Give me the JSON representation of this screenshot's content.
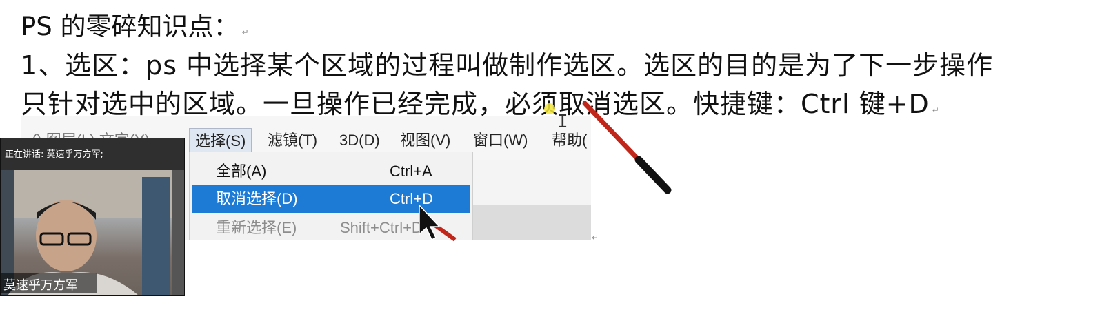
{
  "document": {
    "title": "PS 的零碎知识点：",
    "line1": "1、选区：ps 中选择某个区域的过程叫做制作选区。选区的目的是为了下一步操作",
    "line2": "只针对选中的区域。一旦操作已经完成，必须取消选区。快捷键：Ctrl 键+D",
    "return_mark": "↵"
  },
  "ps_menubar": {
    "items": [
      {
        "label": "()  图层(L)  文字(Y)",
        "state": "partial"
      },
      {
        "label": "选择(S)",
        "state": "active"
      },
      {
        "label": "滤镜(T)"
      },
      {
        "label": "3D(D)"
      },
      {
        "label": "视图(V)"
      },
      {
        "label": "窗口(W)"
      },
      {
        "label": "帮助("
      }
    ]
  },
  "ps_select_menu": {
    "items": [
      {
        "label": "全部(A)",
        "shortcut": "Ctrl+A",
        "state": "normal"
      },
      {
        "label": "取消选择(D)",
        "shortcut": "Ctrl+D",
        "state": "selected"
      },
      {
        "label": "重新选择(E)",
        "shortcut": "Shift+Ctrl+D",
        "state": "disabled"
      }
    ],
    "selected_color": "#1d7bd6"
  },
  "webcam": {
    "speaking_label": "正在讲话: 莫速乎万方军;",
    "participant_name": "莫速乎万方军"
  },
  "colors": {
    "pointer_red": "#c0271a",
    "pointer_black": "#111111",
    "highlight_yellow": "#f2e63a"
  }
}
